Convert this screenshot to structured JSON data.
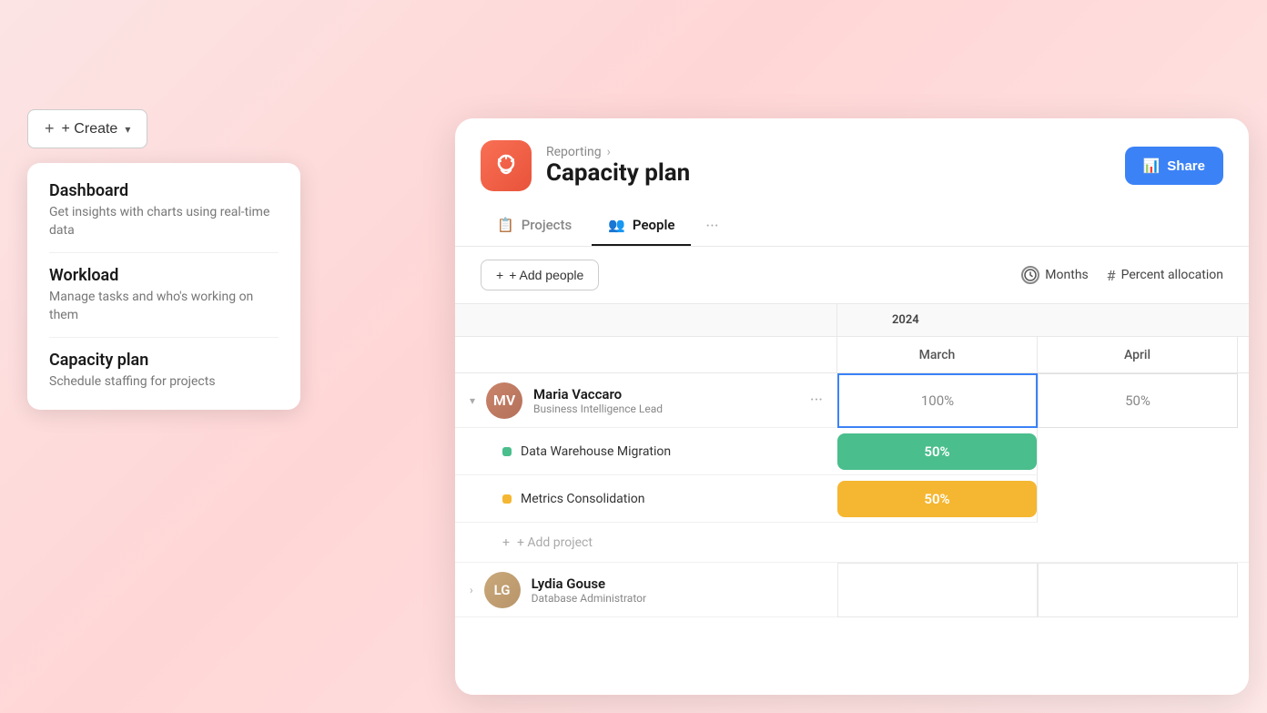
{
  "background": "#fce4e4",
  "create_button": {
    "label": "+ Create",
    "chevron": "▾"
  },
  "dropdown": {
    "items": [
      {
        "title": "Dashboard",
        "description": "Get insights with charts using real-time data"
      },
      {
        "title": "Workload",
        "description": "Manage tasks and who's working on them"
      },
      {
        "title": "Capacity plan",
        "description": "Schedule staffing for projects"
      }
    ]
  },
  "header": {
    "icon": "🔔",
    "breadcrumb": "Reporting",
    "breadcrumb_chevron": "›",
    "title": "Capacity plan",
    "share_label": "Share",
    "share_icon": "📊"
  },
  "tabs": [
    {
      "label": "Projects",
      "icon": "📋",
      "active": false
    },
    {
      "label": "People",
      "icon": "👥",
      "active": true
    }
  ],
  "tab_more": "···",
  "toolbar": {
    "add_people_label": "+ Add people",
    "months_label": "Months",
    "percent_allocation_label": "Percent allocation"
  },
  "calendar": {
    "year": "2024",
    "months": [
      "March",
      "April"
    ]
  },
  "people": [
    {
      "name": "Maria Vaccaro",
      "role": "Business Intelligence Lead",
      "initials": "MV",
      "march_percent": "100%",
      "april_percent": "50%",
      "projects": [
        {
          "name": "Data Warehouse Migration",
          "color": "#4abe8c",
          "march_percent": "50%",
          "dot_color": "#4abe8c"
        },
        {
          "name": "Metrics Consolidation",
          "color": "#f5b731",
          "march_percent": "50%",
          "dot_color": "#f5b731"
        }
      ]
    },
    {
      "name": "Lydia Gouse",
      "role": "Database Administrator",
      "initials": "LG",
      "march_percent": "",
      "april_percent": ""
    }
  ],
  "add_project_label": "+ Add project"
}
